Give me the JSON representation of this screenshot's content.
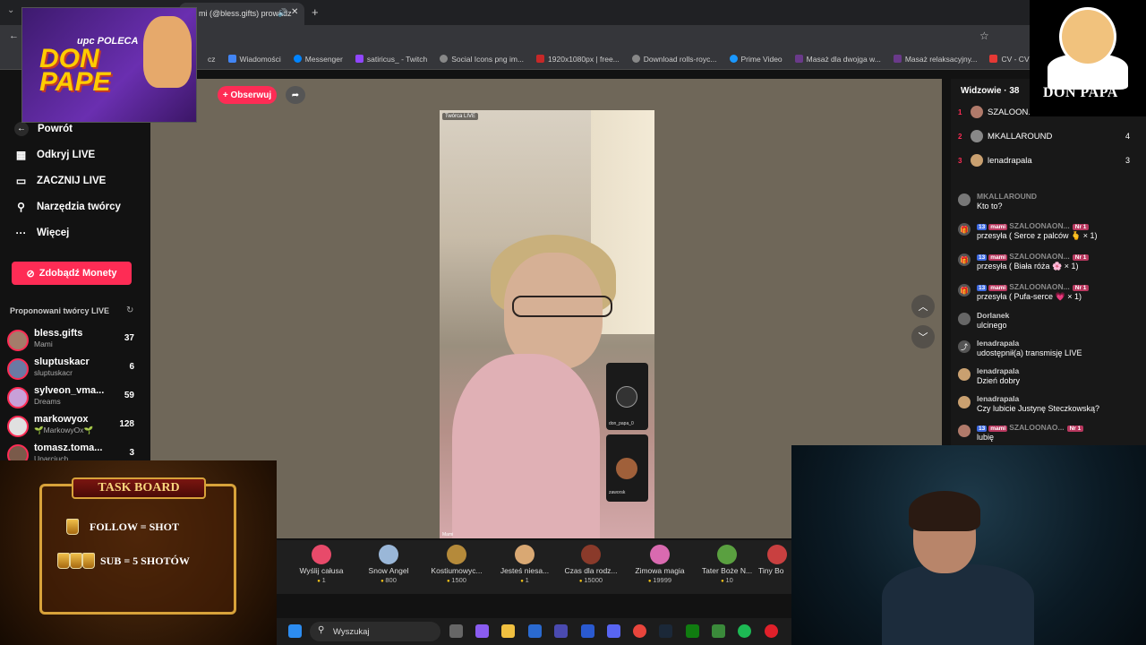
{
  "browser": {
    "tab_title": "mi (@bless.gifts) prowadz",
    "bookmarks": [
      "cz",
      "Wiadomości",
      "Messenger",
      "satiricus_ - Twitch",
      "Social Icons png im...",
      "1920x1080px | free...",
      "Download rolls-royc...",
      "Prime Video",
      "Masaż dla dwojga w...",
      "Masaż relaksacyjny...",
      "CV - CV Maker"
    ]
  },
  "sidebar": {
    "back": "Powrót",
    "items": [
      {
        "label": "Odkryj LIVE",
        "icon": "calendar-icon"
      },
      {
        "label": "ZACZNIJ LIVE",
        "icon": "video-icon"
      },
      {
        "label": "Narzędzia twórcy",
        "icon": "lightbulb-icon"
      },
      {
        "label": "Więcej",
        "icon": "more-icon"
      }
    ],
    "coins_button": "Zdobądź Monety",
    "suggested_title": "Proponowani twórcy LIVE",
    "creators": [
      {
        "name": "bless.gifts",
        "sub": "Mami",
        "count": "37"
      },
      {
        "name": "sluptuskacr",
        "sub": "sluptuskacr",
        "count": "6"
      },
      {
        "name": "sylveon_vma...",
        "sub": "Dreams",
        "count": "59"
      },
      {
        "name": "markowyox",
        "sub": "🌱MarkowyOx🌱",
        "count": "128"
      },
      {
        "name": "tomasz.toma...",
        "sub": "Uparciuch",
        "count": "3"
      }
    ]
  },
  "stream": {
    "follow_button": "+ Obserwuj",
    "badge": "Twórca LIVE",
    "host_name": "Mami",
    "guests": [
      {
        "name": "don_papa_0"
      },
      {
        "name": "zaworsk"
      }
    ]
  },
  "gifts": [
    {
      "label": "Wyślij całusa",
      "price": "1",
      "color": "#e84a6a"
    },
    {
      "label": "Snow Angel",
      "price": "800",
      "color": "#9ab7d8"
    },
    {
      "label": "Kostiumowyc...",
      "price": "1500",
      "color": "#b58a3a"
    },
    {
      "label": "Jesteś niesa...",
      "price": "1",
      "color": "#d9a873"
    },
    {
      "label": "Czas dla rodz...",
      "price": "15000",
      "color": "#8a3a2a"
    },
    {
      "label": "Zimowa magia",
      "price": "19999",
      "color": "#d96ab0"
    },
    {
      "label": "Tater Boże N...",
      "price": "10",
      "color": "#5aa040"
    },
    {
      "label": "Tiny Bo",
      "price": "",
      "color": "#c94040"
    }
  ],
  "viewers": {
    "title": "Widzowie · 38",
    "list": [
      {
        "rank": "1",
        "name": "SZALOON...",
        "count": ""
      },
      {
        "rank": "2",
        "name": "MKALLAROUND",
        "count": "4"
      },
      {
        "rank": "3",
        "name": "lenadrapala",
        "count": "3"
      }
    ]
  },
  "chat": [
    {
      "user": "MKALLAROUND",
      "msg": "Kto to?",
      "icon": "avatar"
    },
    {
      "user": "SZALOONAON...",
      "msg": "przesyła ( Serce z palców 🫰 × 1)",
      "icon": "gift"
    },
    {
      "user": "SZALOONAON...",
      "msg": "przesyła ( Biała róża 🌸 × 1)",
      "icon": "gift"
    },
    {
      "user": "SZALOONAON...",
      "msg": "przesyła ( Pufa-serce 💗 × 1)",
      "icon": "gift"
    },
    {
      "user": "Dorlanek",
      "msg": "ulcinego",
      "icon": "avatar"
    },
    {
      "user": "lenadrapala",
      "msg": "udostępnił(a) transmisję LIVE",
      "icon": "share"
    },
    {
      "user": "lenadrapala",
      "msg": "Dzień dobry",
      "icon": "avatar"
    },
    {
      "user": "lenadrapala",
      "msg": "Czy lubicie Justynę Steczkowską?",
      "icon": "avatar"
    },
    {
      "user": "SZALOONAO...",
      "msg": "lubię",
      "icon": "avatar"
    }
  ],
  "chat_badges": {
    "level": "13",
    "fan": "mami",
    "rank": "Nr 1"
  },
  "overlay_upc": {
    "line1": "upc POLECA",
    "line2": "DON",
    "line3": "PAPE"
  },
  "overlay_logo": "DON PAPA",
  "taskboard": {
    "title": "TASK BOARD",
    "rules": [
      "FOLLOW = SHOT",
      "SUB = 5 SHOTÓW"
    ]
  },
  "taskbar": {
    "search_label": "Wyszukaj"
  }
}
